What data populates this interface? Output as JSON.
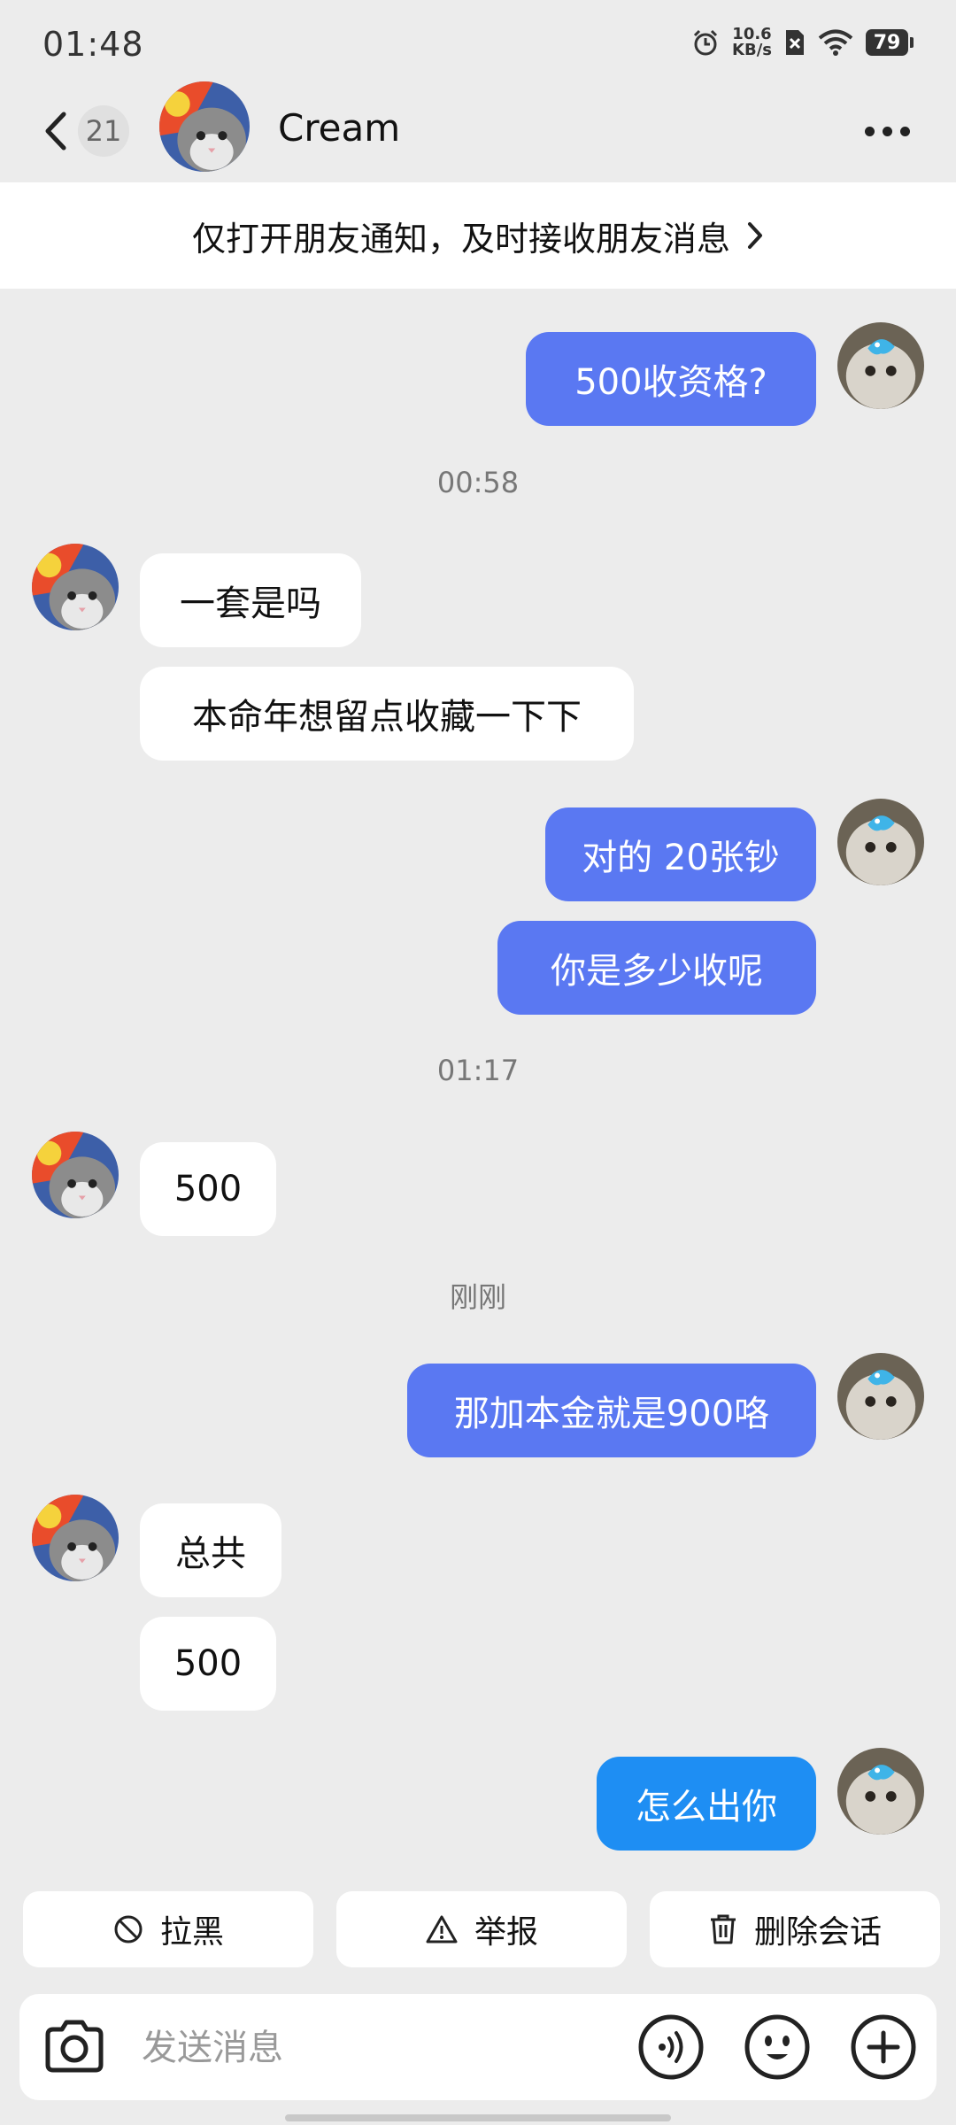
{
  "status_bar": {
    "time": "01:48",
    "net_speed_value": "10.6",
    "net_speed_unit": "KB/s",
    "battery": "79"
  },
  "header": {
    "unread_count": "21",
    "contact_name": "Cream"
  },
  "notice": {
    "text": "仅打开朋友通知，及时接收朋友消息"
  },
  "messages": [
    {
      "from": "me",
      "text": "500收资格?"
    },
    {
      "type": "time",
      "text": "00:58"
    },
    {
      "from": "them",
      "text": "一套是吗"
    },
    {
      "from": "them",
      "text": "本命年想留点收藏一下下"
    },
    {
      "from": "me",
      "text": "对的 20张钞"
    },
    {
      "from": "me",
      "text": "你是多少收呢"
    },
    {
      "type": "time",
      "text": "01:17"
    },
    {
      "from": "them",
      "text": "500"
    },
    {
      "type": "time",
      "text": "刚刚"
    },
    {
      "from": "me",
      "text": "那加本金就是900咯"
    },
    {
      "from": "them",
      "text": "总共"
    },
    {
      "from": "them",
      "text": "500"
    },
    {
      "from": "me",
      "text": "怎么出你"
    }
  ],
  "actions": {
    "block": "拉黑",
    "report": "举报",
    "delete": "删除会话"
  },
  "input": {
    "placeholder": "发送消息"
  },
  "colors": {
    "background": "#ececec",
    "outgoing_bubble": "#5a78f2",
    "latest_outgoing_bubble": "#1e8ef3",
    "incoming_bubble": "#ffffff"
  }
}
